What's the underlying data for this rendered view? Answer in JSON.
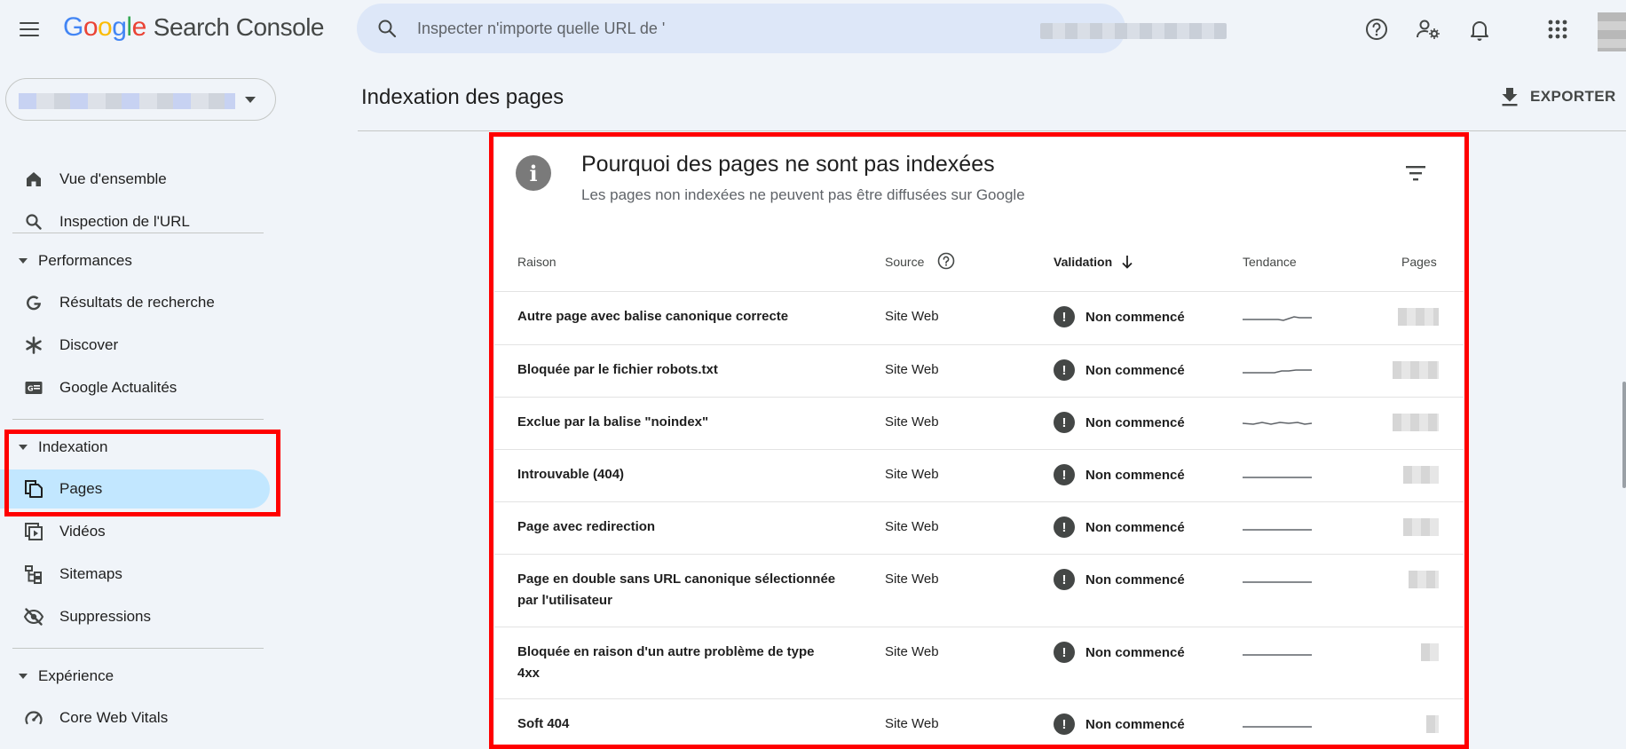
{
  "app": {
    "brand_letters": [
      "G",
      "o",
      "o",
      "g",
      "l",
      "e"
    ],
    "product": "Search Console"
  },
  "search": {
    "placeholder": "Inspecter n'importe quelle URL de '"
  },
  "sidebar": {
    "items": [
      {
        "label": "Vue d'ensemble",
        "icon": "home-icon"
      },
      {
        "label": "Inspection de l'URL",
        "icon": "search-icon"
      }
    ],
    "performance": {
      "label": "Performances",
      "items": [
        {
          "label": "Résultats de recherche",
          "icon": "google-g-icon"
        },
        {
          "label": "Discover",
          "icon": "asterisk-icon"
        },
        {
          "label": "Google Actualités",
          "icon": "news-icon"
        }
      ]
    },
    "indexation": {
      "label": "Indexation",
      "items": [
        {
          "label": "Pages",
          "icon": "pages-icon"
        },
        {
          "label": "Vidéos",
          "icon": "video-icon"
        },
        {
          "label": "Sitemaps",
          "icon": "sitemap-icon"
        },
        {
          "label": "Suppressions",
          "icon": "eye-off-icon"
        }
      ]
    },
    "experience": {
      "label": "Expérience",
      "items": [
        {
          "label": "Core Web Vitals",
          "icon": "gauge-icon"
        }
      ]
    }
  },
  "main": {
    "page_title": "Indexation des pages",
    "export_label": "EXPORTER"
  },
  "card": {
    "title": "Pourquoi des pages ne sont pas indexées",
    "subtitle": "Les pages non indexées ne peuvent pas être diffusées sur Google",
    "columns": {
      "reason": "Raison",
      "source": "Source",
      "validation": "Validation",
      "trend": "Tendance",
      "pages": "Pages"
    },
    "rows": [
      {
        "reason": "Autre page avec balise canonique correcte",
        "source": "Site Web",
        "validation": "Non commencé"
      },
      {
        "reason": "Bloquée par le fichier robots.txt",
        "source": "Site Web",
        "validation": "Non commencé"
      },
      {
        "reason": "Exclue par la balise \"noindex\"",
        "source": "Site Web",
        "validation": "Non commencé"
      },
      {
        "reason": "Introuvable (404)",
        "source": "Site Web",
        "validation": "Non commencé"
      },
      {
        "reason": "Page avec redirection",
        "source": "Site Web",
        "validation": "Non commencé"
      },
      {
        "reason": "Page en double sans URL canonique sélectionnée par l'utilisateur",
        "source": "Site Web",
        "validation": "Non commencé"
      },
      {
        "reason": "Bloquée en raison d'un autre problème de type 4xx",
        "source": "Site Web",
        "validation": "Non commencé"
      },
      {
        "reason": "Soft 404",
        "source": "Site Web",
        "validation": "Non commencé"
      }
    ]
  },
  "colors": {
    "background": "#f0f4f9",
    "search_bg": "#dde7f8",
    "active_nav": "#c2e7ff",
    "highlight": "#ff0000",
    "status_icon": "#444746"
  }
}
